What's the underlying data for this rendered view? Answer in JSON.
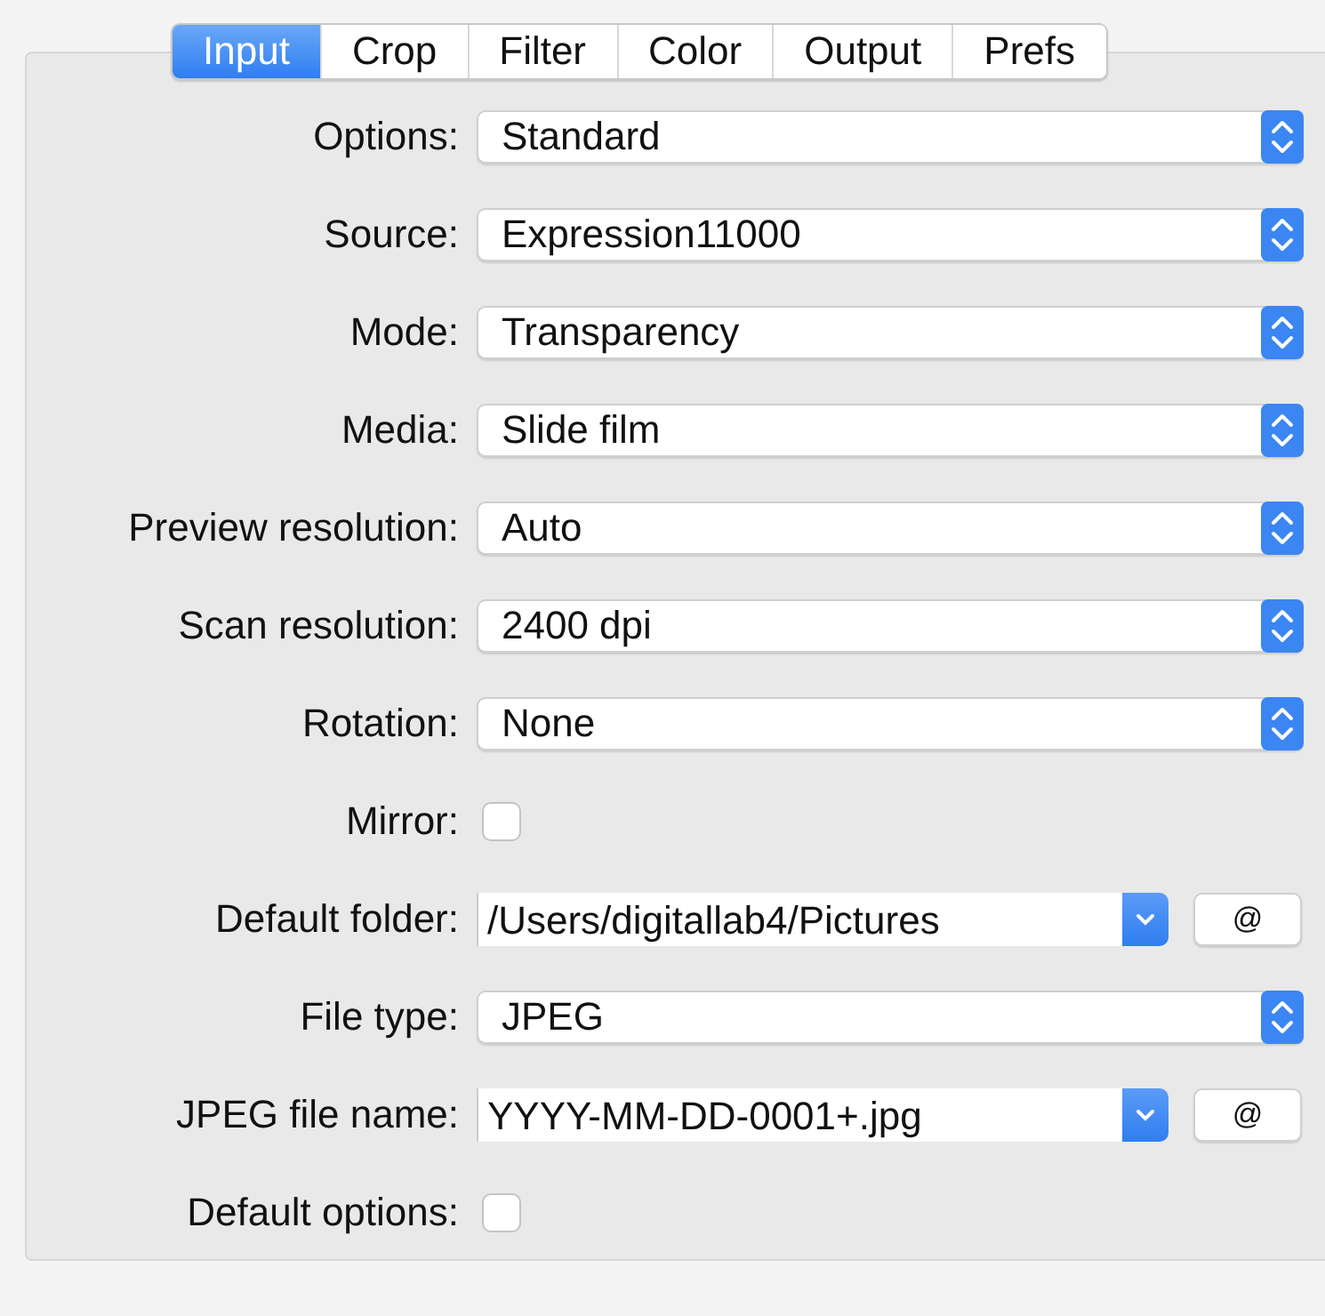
{
  "tabs": [
    {
      "label": "Input",
      "selected": true
    },
    {
      "label": "Crop",
      "selected": false
    },
    {
      "label": "Filter",
      "selected": false
    },
    {
      "label": "Color",
      "selected": false
    },
    {
      "label": "Output",
      "selected": false
    },
    {
      "label": "Prefs",
      "selected": false
    }
  ],
  "rows": [
    {
      "kind": "popup",
      "label": "Options:",
      "value": "Standard"
    },
    {
      "kind": "popup",
      "label": "Source:",
      "value": "Expression11000"
    },
    {
      "kind": "popup",
      "label": "Mode:",
      "value": "Transparency"
    },
    {
      "kind": "popup",
      "label": "Media:",
      "value": "Slide film"
    },
    {
      "kind": "popup",
      "label": "Preview resolution:",
      "value": "Auto"
    },
    {
      "kind": "popup",
      "label": "Scan resolution:",
      "value": "2400 dpi"
    },
    {
      "kind": "popup",
      "label": "Rotation:",
      "value": "None"
    },
    {
      "kind": "checkbox",
      "label": "Mirror:",
      "checked": false
    },
    {
      "kind": "combo",
      "label": "Default folder:",
      "value": "/Users/digitallab4/Pictures",
      "button": "@"
    },
    {
      "kind": "popup",
      "label": "File type:",
      "value": "JPEG"
    },
    {
      "kind": "combo",
      "label": "JPEG file name:",
      "value": "YYYY-MM-DD-0001+.jpg",
      "button": "@"
    },
    {
      "kind": "checkbox",
      "label": "Default options:",
      "checked": false
    }
  ]
}
